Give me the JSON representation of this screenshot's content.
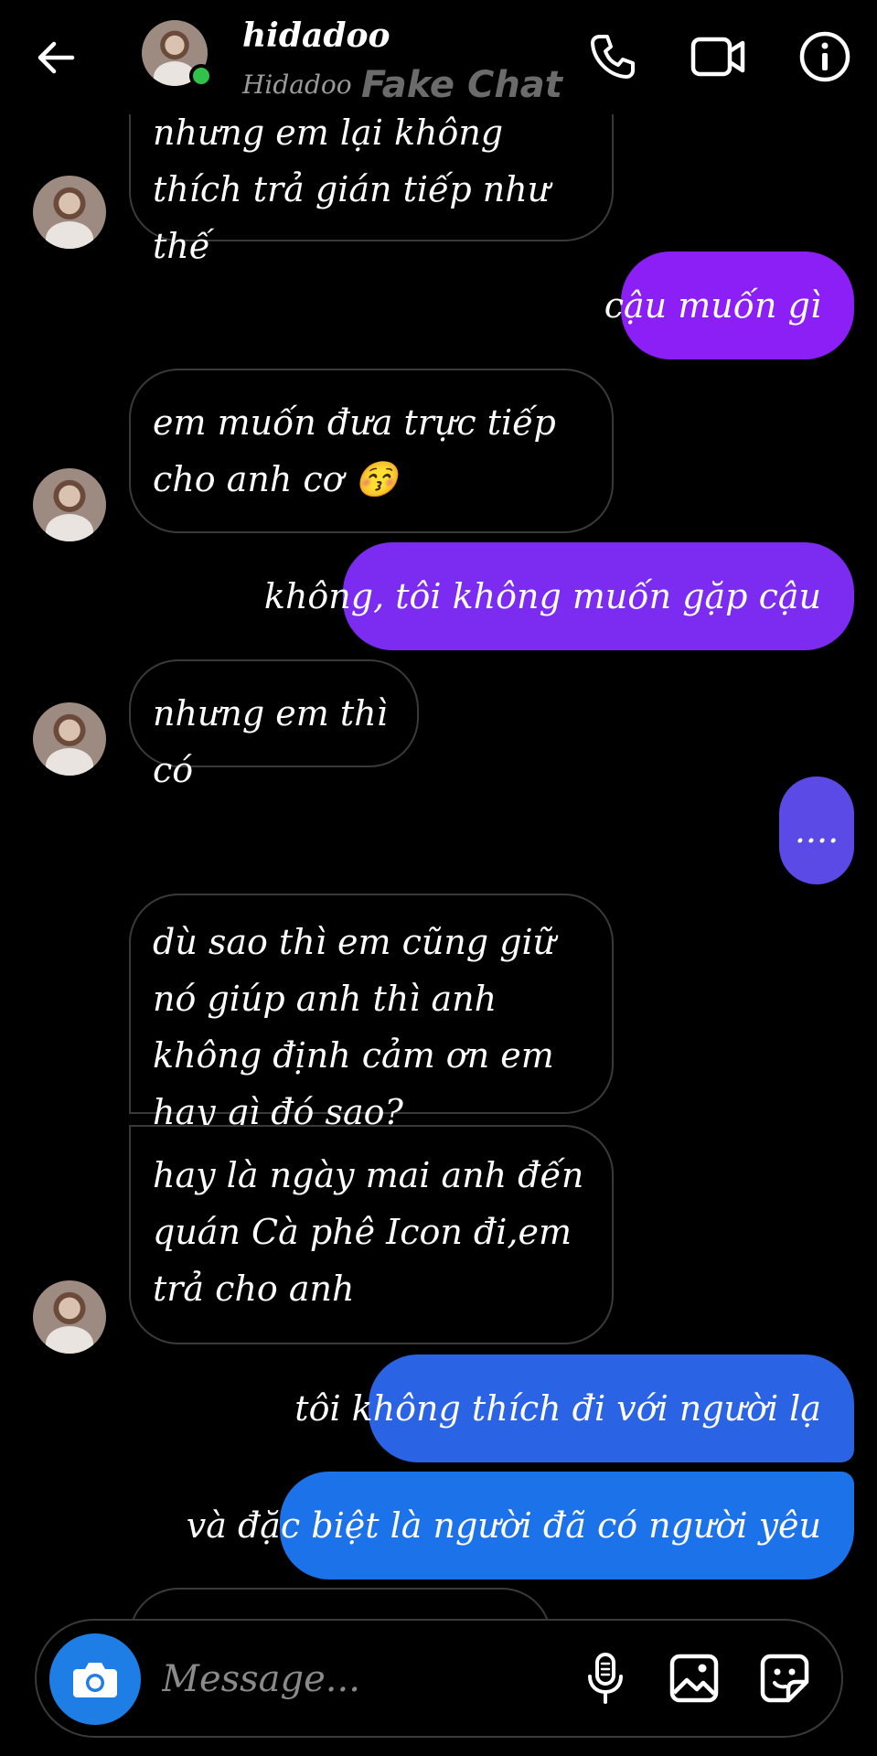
{
  "header": {
    "name": "hidadoo",
    "subtitle": "Hidadoo",
    "watermark": "Fake Chat",
    "icons": [
      "back-arrow-icon",
      "phone-icon",
      "video-camera-icon",
      "info-icon"
    ],
    "online_color": "#31c24c"
  },
  "messages": [
    {
      "side": "in",
      "text": "nhưng em lại không thích trả gián tiếp như thế",
      "avatar": true
    },
    {
      "side": "out",
      "text": "cậu muốn gì",
      "color": "#8b1ff5"
    },
    {
      "side": "in",
      "text": "em muốn đưa trực tiếp cho anh cơ 😚",
      "avatar": true
    },
    {
      "side": "out",
      "text": "không, tôi không muốn gặp cậu",
      "color": "#7b2cf0"
    },
    {
      "side": "in",
      "text": "nhưng em thì có",
      "avatar": true
    },
    {
      "side": "out",
      "text": "....",
      "color": "#5b4ae6"
    },
    {
      "side": "in",
      "text": "dù sao thì em cũng giữ nó giúp anh thì anh không định cảm ơn em hay gì đó sao?",
      "avatar": false
    },
    {
      "side": "in",
      "text": "hay là ngày mai anh đến quán Cà phê Icon đi,em trả cho anh",
      "avatar": true
    },
    {
      "side": "out",
      "text": "tôi không thích đi với người lạ",
      "color": "#2a63e3"
    },
    {
      "side": "out",
      "text": "và đặc biệt là người đã có người yêu",
      "color": "#1c72e8"
    }
  ],
  "composer": {
    "placeholder": "Message...",
    "camera_color": "#1e7ee6",
    "icons": [
      "camera-icon",
      "microphone-icon",
      "image-icon",
      "sticker-icon"
    ]
  }
}
